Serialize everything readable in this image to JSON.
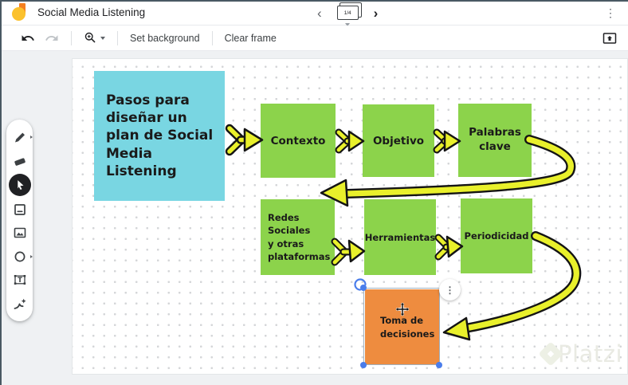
{
  "colors": {
    "cyan_note": "#79D6E2",
    "green_note": "#8CD34B",
    "orange_note": "#EE8C3F",
    "arrow_yellow": "#E9F02B",
    "selection_blue": "#4A7DEB"
  },
  "header": {
    "title": "Social Media Listening",
    "prev_frame": "‹",
    "next_frame": "›",
    "frame_counter": "1/4",
    "overflow_menu": "⋮"
  },
  "toolbar": {
    "set_background": "Set background",
    "clear_frame": "Clear frame"
  },
  "tools": {
    "active": "select",
    "items": [
      "pen",
      "eraser",
      "select",
      "sticky-note",
      "image",
      "shape",
      "text-box",
      "laser"
    ]
  },
  "canvas": {
    "shapes": [
      {
        "id": "intro",
        "label": "Pasos para\ndiseñar un\nplan de Social\nMedia\nListening",
        "color": "cyan_note"
      },
      {
        "id": "contexto",
        "label": "Contexto",
        "color": "green_note"
      },
      {
        "id": "objetivo",
        "label": "Objetivo",
        "color": "green_note"
      },
      {
        "id": "palabras-clave",
        "label": "Palabras\nclave",
        "color": "green_note"
      },
      {
        "id": "redes-sociales",
        "label": "Redes Sociales\ny otras\nplataformas",
        "color": "green_note"
      },
      {
        "id": "herramientas",
        "label": "Herramientas",
        "color": "green_note"
      },
      {
        "id": "periodicidad",
        "label": "Periodicidad",
        "color": "green_note"
      },
      {
        "id": "toma-decisiones",
        "label": "Toma de\ndecisiones",
        "color": "orange_note",
        "selected": true
      }
    ],
    "selection": {
      "menu_icon": "⋮"
    },
    "watermark": "Platzi"
  }
}
